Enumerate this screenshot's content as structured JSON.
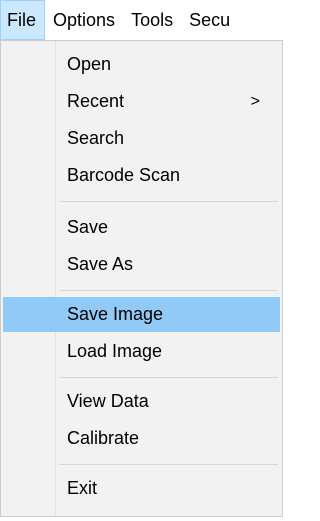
{
  "menubar": {
    "items": [
      "File",
      "Options",
      "Tools",
      "Secu"
    ],
    "active_index": 0
  },
  "file_menu": {
    "groups": [
      [
        {
          "label": "Open"
        },
        {
          "label": "Recent",
          "submenu_glyph": ">"
        },
        {
          "label": "Search"
        },
        {
          "label": "Barcode Scan"
        }
      ],
      [
        {
          "label": "Save"
        },
        {
          "label": "Save As"
        }
      ],
      [
        {
          "label": "Save Image",
          "highlighted": true
        },
        {
          "label": "Load Image"
        }
      ],
      [
        {
          "label": "View Data"
        },
        {
          "label": "Calibrate"
        }
      ],
      [
        {
          "label": "Exit"
        }
      ]
    ]
  },
  "colors": {
    "menu_background": "#f2f2f2",
    "highlight": "#91c9f7",
    "active_menubar_item": "#cce8ff",
    "separator": "#d7d7d7"
  }
}
